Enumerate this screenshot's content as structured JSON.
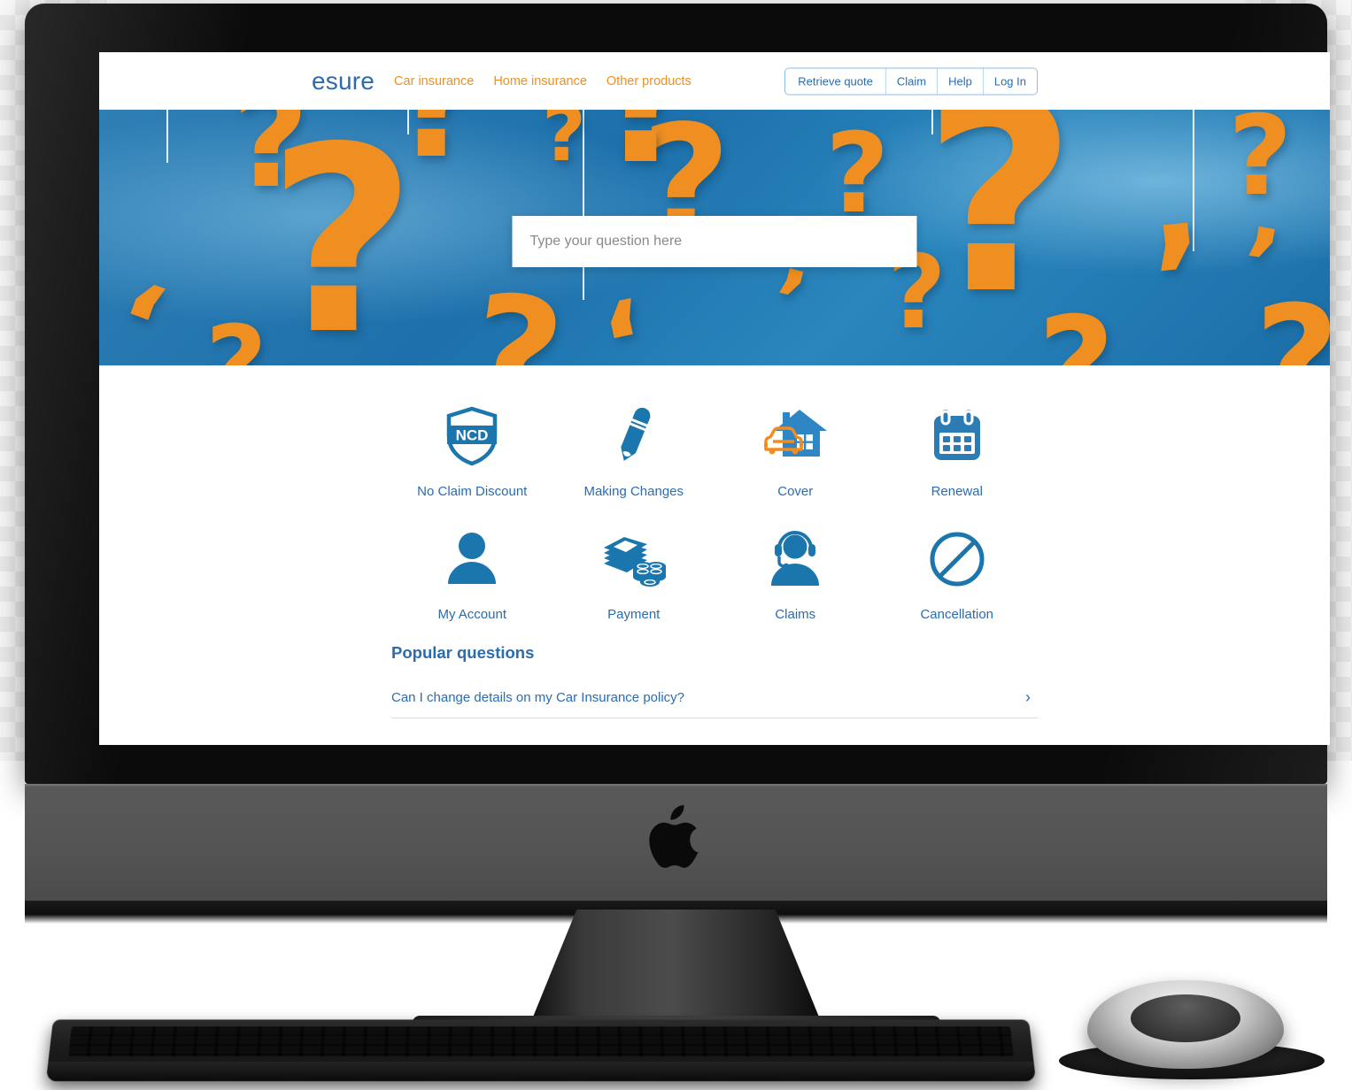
{
  "device": {
    "type": "imac-desktop-computer",
    "brand_logo": "apple-logo"
  },
  "site": {
    "logo_text": "esure",
    "logo_color": "#2b6cb0",
    "accent_color": "#f0901f",
    "link_color": "#2b6cb0"
  },
  "header": {
    "nav": [
      {
        "label": "Car insurance"
      },
      {
        "label": "Home insurance"
      },
      {
        "label": "Other products"
      }
    ],
    "auth_buttons": [
      {
        "label": "Retrieve quote"
      },
      {
        "label": "Claim"
      },
      {
        "label": "Help"
      },
      {
        "label": "Log In"
      }
    ]
  },
  "hero": {
    "background": "orange-question-marks-on-blue",
    "search": {
      "placeholder": "Type your question here",
      "value": ""
    }
  },
  "tiles": [
    {
      "label": "No Claim Discount",
      "icon": "ncd-shield-icon",
      "badge_text": "NCD"
    },
    {
      "label": "Making Changes",
      "icon": "pencil-icon"
    },
    {
      "label": "Cover",
      "icon": "house-and-car-icon"
    },
    {
      "label": "Renewal",
      "icon": "calendar-icon"
    },
    {
      "label": "My Account",
      "icon": "person-icon"
    },
    {
      "label": "Payment",
      "icon": "banknotes-and-coins-icon"
    },
    {
      "label": "Claims",
      "icon": "headset-agent-icon"
    },
    {
      "label": "Cancellation",
      "icon": "prohibited-circle-icon"
    }
  ],
  "popular": {
    "title": "Popular questions",
    "questions": [
      {
        "text": "Can I change details on my Car Insurance policy?",
        "chevron": "›"
      }
    ]
  }
}
